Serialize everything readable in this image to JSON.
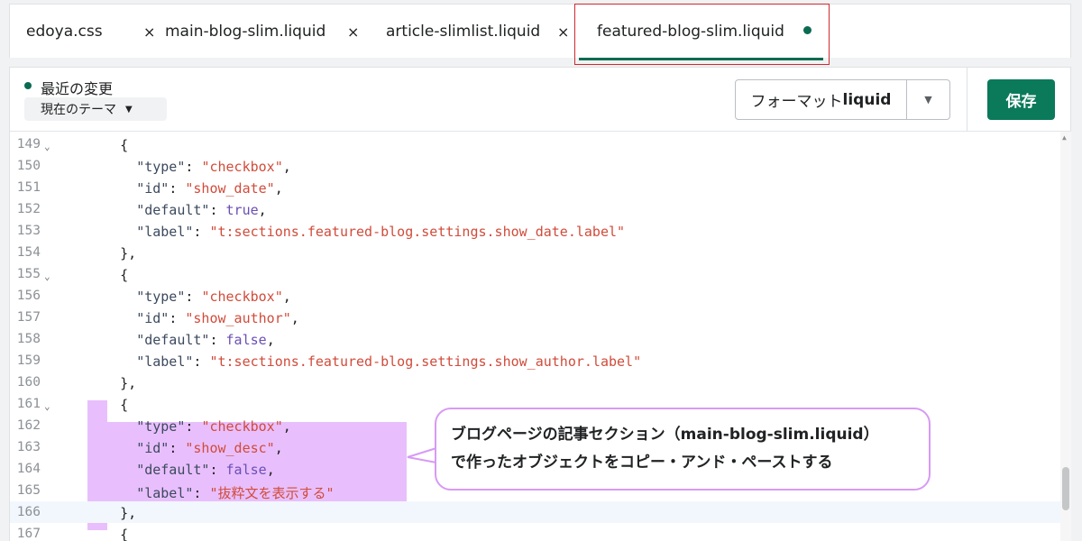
{
  "tabs": [
    {
      "label": "edoya.css",
      "close": "×"
    },
    {
      "label": "main-blog-slim.liquid",
      "close": "×"
    },
    {
      "label": "article-slimlist.liquid",
      "close": "×"
    },
    {
      "label": "featured-blog-slim.liquid",
      "active": true,
      "modified": true
    }
  ],
  "header": {
    "changes_label": "最近の変更",
    "theme_select": "現在のテーマ",
    "format_prefix": "フォーマット",
    "format_bold": "liquid",
    "save_label": "保存"
  },
  "colors": {
    "accent": "#0b7a5a",
    "highlight": "#e8bffc",
    "callout_border": "#d79af5",
    "active_tab_outline": "#d0292f"
  },
  "editor": {
    "current_line": 166,
    "lines": [
      {
        "n": "149",
        "fold": true,
        "text": "    {"
      },
      {
        "n": "150",
        "text": "      \"type\": \"checkbox\","
      },
      {
        "n": "151",
        "text": "      \"id\": \"show_date\","
      },
      {
        "n": "152",
        "text": "      \"default\": true,"
      },
      {
        "n": "153",
        "text": "      \"label\": \"t:sections.featured-blog.settings.show_date.label\""
      },
      {
        "n": "154",
        "text": "    },"
      },
      {
        "n": "155",
        "fold": true,
        "text": "    {"
      },
      {
        "n": "156",
        "text": "      \"type\": \"checkbox\","
      },
      {
        "n": "157",
        "text": "      \"id\": \"show_author\","
      },
      {
        "n": "158",
        "text": "      \"default\": false,"
      },
      {
        "n": "159",
        "text": "      \"label\": \"t:sections.featured-blog.settings.show_author.label\""
      },
      {
        "n": "160",
        "text": "    },"
      },
      {
        "n": "161",
        "fold": true,
        "text": "    {"
      },
      {
        "n": "162",
        "text": "      \"type\": \"checkbox\","
      },
      {
        "n": "163",
        "text": "      \"id\": \"show_desc\","
      },
      {
        "n": "164",
        "text": "      \"default\": false,"
      },
      {
        "n": "165",
        "text": "      \"label\": \"抜粋文を表示する\""
      },
      {
        "n": "166",
        "text": "    },"
      },
      {
        "n": "167",
        "text": "    {"
      }
    ]
  },
  "callout": {
    "line1": "ブログページの記事セクション（main-blog-slim.liquid）",
    "line2": "で作ったオブジェクトをコピー・アンド・ペーストする"
  }
}
